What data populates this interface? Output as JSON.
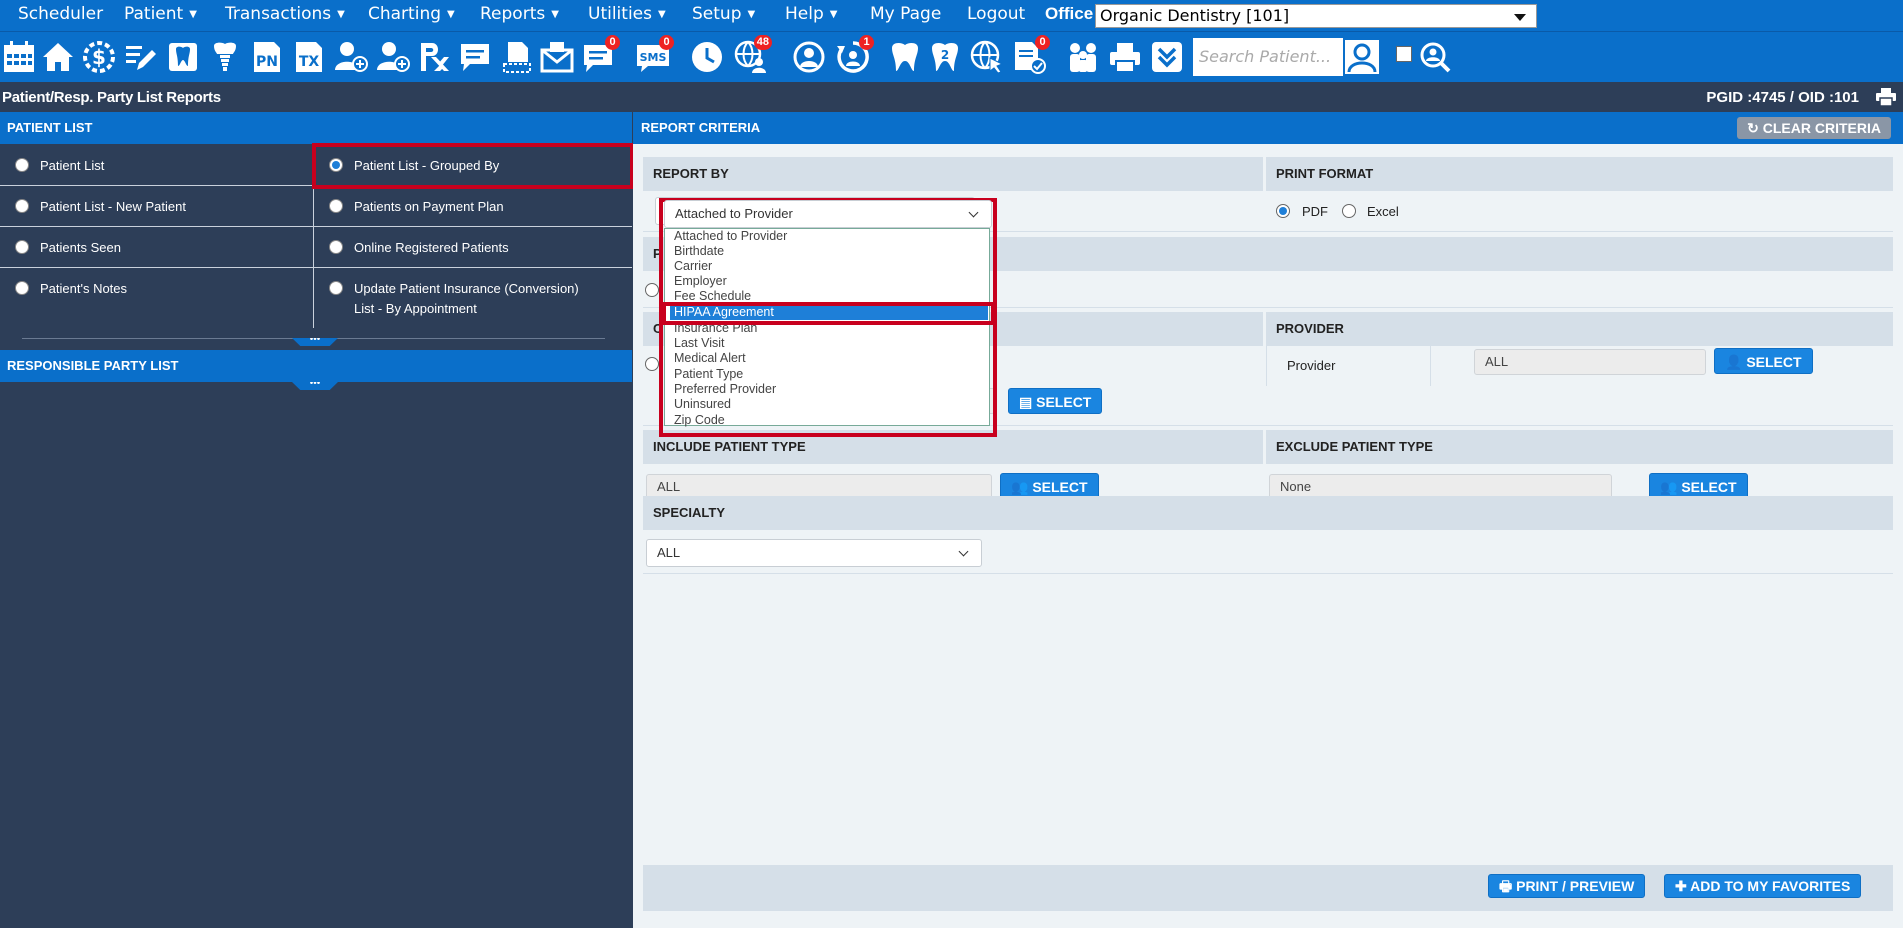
{
  "menu": {
    "items": [
      "Scheduler",
      "Patient",
      "Transactions",
      "Charting",
      "Reports",
      "Utilities",
      "Setup",
      "Help",
      "My Page",
      "Logout"
    ],
    "office_label": "Office",
    "office_value": "Organic Dentistry [101]"
  },
  "toolbar": {
    "pn_label": "PN",
    "tx_label": "TX",
    "sms_label": "SMS",
    "badges": {
      "messages": "0",
      "sms": "0",
      "notifications": "48",
      "recall": "1",
      "forms": "0"
    },
    "search_placeholder": "Search Patient..."
  },
  "titlebar": {
    "title": "Patient/Resp. Party List Reports",
    "ids": "PGID :4745  /  OID :101"
  },
  "left": {
    "patient_list_header": "PATIENT LIST",
    "options": [
      {
        "left": "Patient List",
        "right": "Patient List - Grouped By"
      },
      {
        "left": "Patient List - New Patient",
        "right": "Patients on Payment Plan"
      },
      {
        "left": "Patients Seen",
        "right": "Online Registered Patients"
      },
      {
        "left": "Patient's Notes",
        "right": "Update Patient Insurance (Conversion)",
        "right2": "List - By Appointment"
      }
    ],
    "grip": "•••",
    "resp_header": "RESPONSIBLE PARTY LIST"
  },
  "right": {
    "header": "REPORT CRITERIA",
    "clear_btn": "CLEAR CRITERIA",
    "report_by": "REPORT BY",
    "report_by_value": "Attached to Provider",
    "print_format": "PRINT FORMAT",
    "pdf": "PDF",
    "excel": "Excel",
    "provider_head": "PROVIDER",
    "provider_label": "Provider",
    "provider_value": "ALL",
    "select": "SELECT",
    "include_type": "INCLUDE PATIENT TYPE",
    "include_value": "ALL",
    "exclude_type": "EXCLUDE PATIENT TYPE",
    "exclude_value": "None",
    "specialty": "SPECIALTY",
    "specialty_value": "ALL",
    "partial_letter_1": "P",
    "partial_letter_2": "C",
    "print_preview": "PRINT / PREVIEW",
    "add_favorites": "ADD TO MY FAVORITES"
  },
  "dropdown": {
    "options": [
      "Attached to Provider",
      "Birthdate",
      "Carrier",
      "Employer",
      "Fee Schedule",
      "HIPAA Agreement",
      "Insurance Plan",
      "Last Visit",
      "Medical Alert",
      "Patient Type",
      "Preferred Provider",
      "Uninsured",
      "Zip Code"
    ],
    "selected_index": 5
  },
  "colors": {
    "primary": "#0a6fca",
    "dark": "#2d3e58",
    "highlight": "#c8001e",
    "accent": "#1a85e0"
  }
}
